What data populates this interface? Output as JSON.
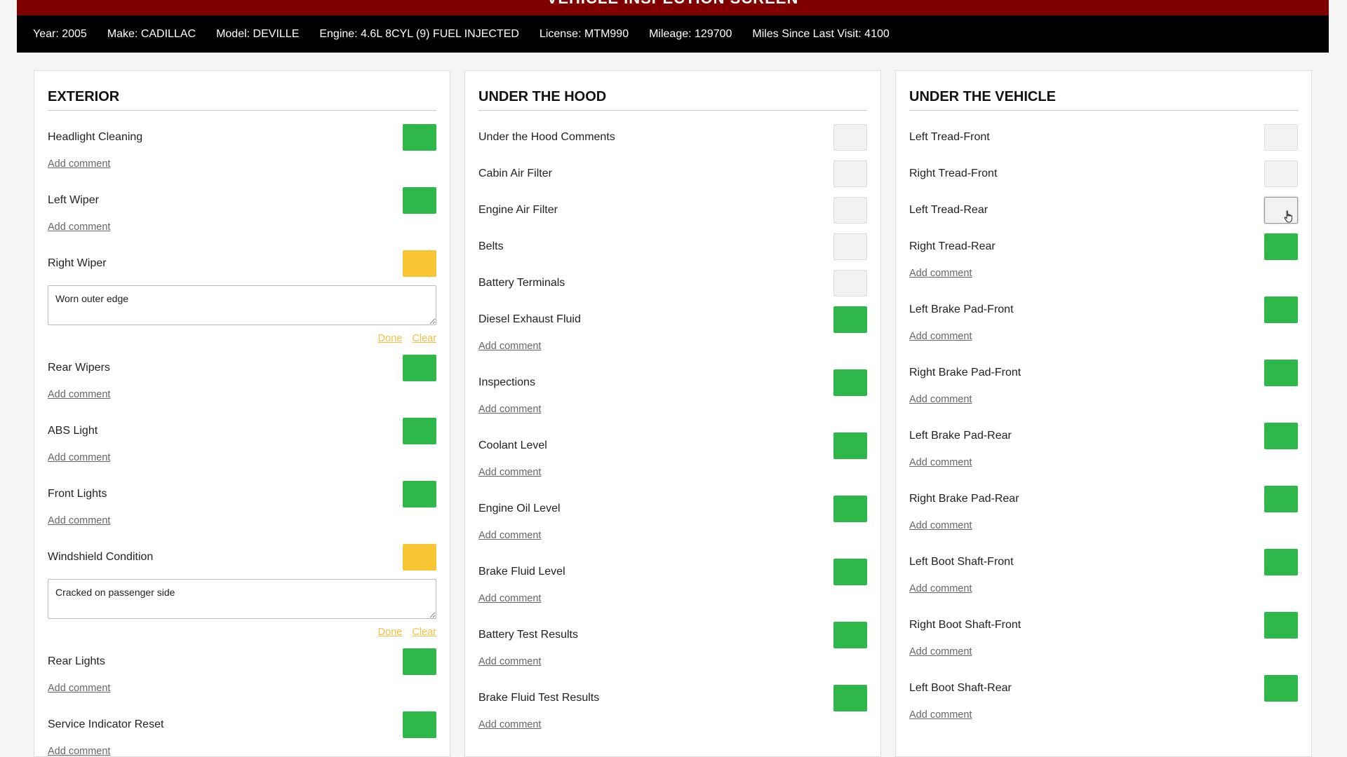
{
  "title": "VEHICLE INSPECTION SCREEN",
  "vehicle": {
    "year": "Year: 2005",
    "make": "Make: CADILLAC",
    "model": "Model: DEVILLE",
    "engine": "Engine: 4.6L 8CYL (9) FUEL INJECTED",
    "license": "License: MTM990",
    "mileage": "Mileage: 129700",
    "miles_since": "Miles Since Last Visit: 4100"
  },
  "add_comment_label": "Add comment",
  "done_label": "Done",
  "clear_label": "Clear",
  "colors": {
    "ok": "#2fb84a",
    "warn": "#f7c533",
    "none": "#f2f2f2",
    "header": "#800000"
  },
  "exterior": {
    "title": "EXTERIOR",
    "items": [
      {
        "label": "Headlight Cleaning",
        "status": "ok"
      },
      {
        "label": "Left Wiper",
        "status": "ok"
      },
      {
        "label": "Right Wiper",
        "status": "warn",
        "comment": "Worn outer edge"
      },
      {
        "label": "Rear Wipers",
        "status": "ok"
      },
      {
        "label": "ABS Light",
        "status": "ok"
      },
      {
        "label": "Front Lights",
        "status": "ok"
      },
      {
        "label": "Windshield Condition",
        "status": "warn",
        "comment": "Cracked on passenger side"
      },
      {
        "label": "Rear Lights",
        "status": "ok"
      },
      {
        "label": "Service Indicator Reset",
        "status": "ok"
      }
    ]
  },
  "hood": {
    "title": "UNDER THE HOOD",
    "items": [
      {
        "label": "Under the Hood Comments",
        "status": "none"
      },
      {
        "label": "Cabin Air Filter",
        "status": "none"
      },
      {
        "label": "Engine Air Filter",
        "status": "none"
      },
      {
        "label": "Belts",
        "status": "none"
      },
      {
        "label": "Battery Terminals",
        "status": "none"
      },
      {
        "label": "Diesel Exhaust Fluid",
        "status": "ok"
      },
      {
        "label": "Inspections",
        "status": "ok"
      },
      {
        "label": "Coolant Level",
        "status": "ok"
      },
      {
        "label": "Engine Oil Level",
        "status": "ok"
      },
      {
        "label": "Brake Fluid Level",
        "status": "ok"
      },
      {
        "label": "Battery Test Results",
        "status": "ok"
      },
      {
        "label": "Brake Fluid Test Results",
        "status": "ok"
      }
    ]
  },
  "vehicle_under": {
    "title": "UNDER THE VEHICLE",
    "items": [
      {
        "label": "Left Tread-Front",
        "status": "none"
      },
      {
        "label": "Right Tread-Front",
        "status": "none"
      },
      {
        "label": "Left Tread-Rear",
        "status": "hover"
      },
      {
        "label": "Right Tread-Rear",
        "status": "ok"
      },
      {
        "label": "Left Brake Pad-Front",
        "status": "ok"
      },
      {
        "label": "Right Brake Pad-Front",
        "status": "ok"
      },
      {
        "label": "Left Brake Pad-Rear",
        "status": "ok"
      },
      {
        "label": "Right Brake Pad-Rear",
        "status": "ok"
      },
      {
        "label": "Left Boot Shaft-Front",
        "status": "ok"
      },
      {
        "label": "Right Boot Shaft-Front",
        "status": "ok"
      },
      {
        "label": "Left Boot Shaft-Rear",
        "status": "ok"
      }
    ]
  }
}
